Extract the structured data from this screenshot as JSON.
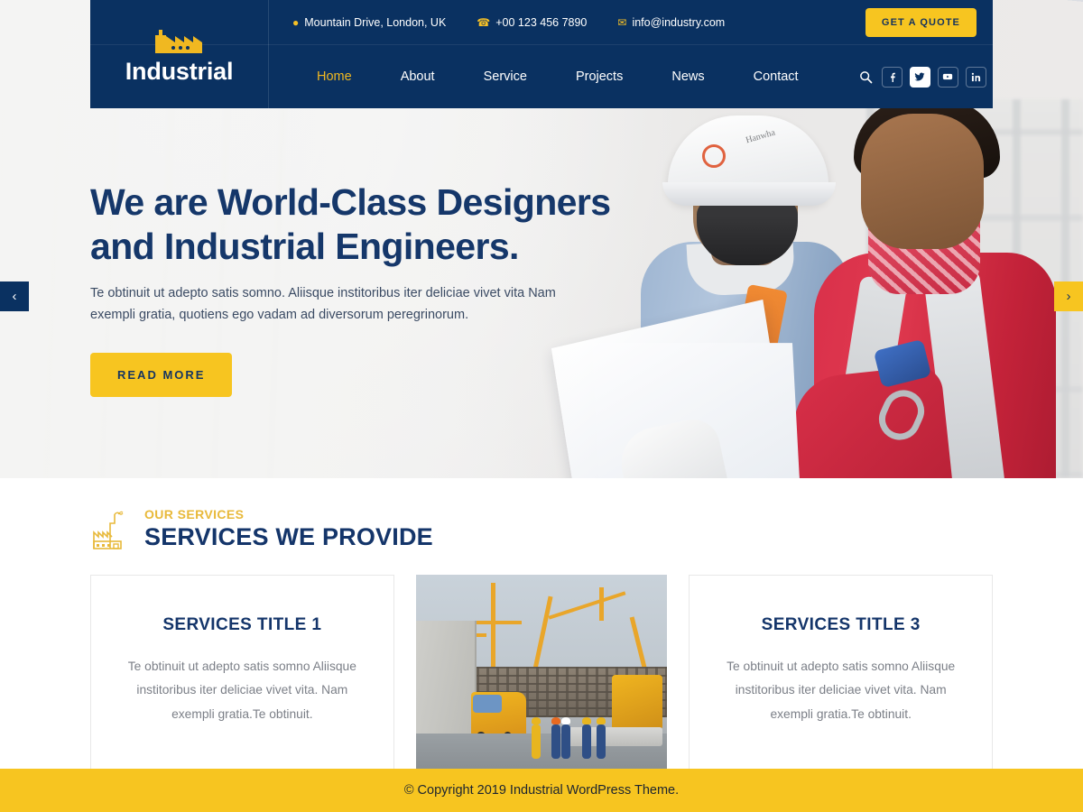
{
  "header": {
    "logo": {
      "icon": "factory-icon",
      "text": "Industrial"
    },
    "topbar": {
      "address": {
        "icon": "map-pin-icon",
        "text": "Mountain Drive, London, UK"
      },
      "phone": {
        "icon": "phone-icon",
        "text": "+00 123 456 7890"
      },
      "email": {
        "icon": "envelope-icon",
        "text": "info@industry.com"
      },
      "quote_label": "GET A QUOTE"
    },
    "nav": [
      {
        "label": "Home",
        "active": true
      },
      {
        "label": "About",
        "active": false
      },
      {
        "label": "Service",
        "active": false
      },
      {
        "label": "Projects",
        "active": false
      },
      {
        "label": "News",
        "active": false
      },
      {
        "label": "Contact",
        "active": false
      }
    ],
    "search_icon": "search-icon",
    "socials": [
      {
        "name": "facebook-icon",
        "glyph": "f",
        "active": false
      },
      {
        "name": "twitter-icon",
        "glyph": "t",
        "active": true
      },
      {
        "name": "youtube-icon",
        "glyph": "y",
        "active": false
      },
      {
        "name": "linkedin-icon",
        "glyph": "in",
        "active": false
      }
    ]
  },
  "hero": {
    "title_line1": "We are World-Class Designers",
    "title_line2": "and Industrial Engineers.",
    "subtitle_line1": "Te obtinuit ut adepto satis somno. Aliisque institoribus iter deliciae vivet vita",
    "subtitle_line2": "Nam exempli gratia, quotiens ego vadam ad diversorum peregrinorum.",
    "cta_label": "READ MORE",
    "prev_label": "‹",
    "next_label": "›",
    "image_alt": "two-engineers-reviewing-blueprint"
  },
  "services": {
    "eyebrow": "OUR SERVICES",
    "title": "SERVICES WE PROVIDE",
    "icon": "factory-outline-icon",
    "cards": [
      {
        "type": "text",
        "title": "SERVICES TITLE 1",
        "text": "Te obtinuit ut adepto satis somno Aliisque institoribus iter deliciae vivet vita. Nam exempli gratia.Te obtinuit."
      },
      {
        "type": "image",
        "title": "",
        "text": "",
        "image_alt": "construction-site-with-cranes-and-workers"
      },
      {
        "type": "text",
        "title": "SERVICES TITLE 3",
        "text": "Te obtinuit ut adepto satis somno Aliisque institoribus iter deliciae vivet vita. Nam exempli gratia.Te obtinuit."
      }
    ]
  },
  "footer": {
    "copyright": "© Copyright 2019 Industrial WordPress Theme."
  },
  "colors": {
    "navy": "#0a3161",
    "navy_text": "#14356a",
    "gold": "#f7c520",
    "gold_text": "#e8b93a",
    "body_text": "#7b7f87"
  }
}
